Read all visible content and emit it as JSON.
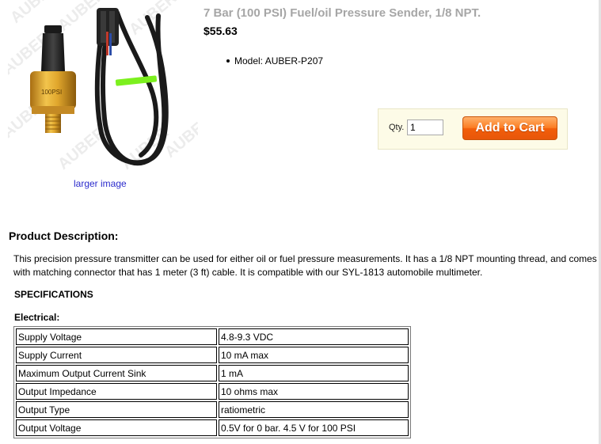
{
  "product": {
    "title": "7 Bar (100 PSI) Fuel/oil Pressure Sender, 1/8 NPT.",
    "price": "$55.63",
    "model": "Model: AUBER-P207",
    "larger_image_link": "larger image",
    "image_text": {
      "sensor_label": "100PSI",
      "watermark": "AUBER"
    }
  },
  "cart": {
    "qty_label": "Qty.",
    "qty_value": "1",
    "add_to_cart_label": "Add to Cart"
  },
  "description": {
    "heading": "Product Description:",
    "text": "This precision pressure transmitter can be used for either oil or fuel pressure measurements. It  has a 1/8 NPT mounting thread, and comes with matching connector that has 1 meter (3 ft) cable.  It is compatible with our SYL-1813 automobile multimeter.",
    "specifications_heading": "SPECIFICATIONS",
    "electrical_heading": "Electrical:"
  },
  "specs": [
    {
      "name": "Supply Voltage",
      "value": "4.8-9.3 VDC"
    },
    {
      "name": "Supply Current",
      "value": "10 mA max"
    },
    {
      "name": "Maximum Output Current Sink",
      "value": "1 mA"
    },
    {
      "name": "Output Impedance",
      "value": "10 ohms max"
    },
    {
      "name": "Output Type",
      "value": "ratiometric"
    },
    {
      "name": "Output Voltage",
      "value": "0.5V for 0 bar. 4.5 V for 100 PSI"
    }
  ],
  "colors": {
    "title": "#a6a6a6",
    "link": "#2b2bcc",
    "cart_button": "#f26b12",
    "cart_box": "#fdfbe7"
  }
}
